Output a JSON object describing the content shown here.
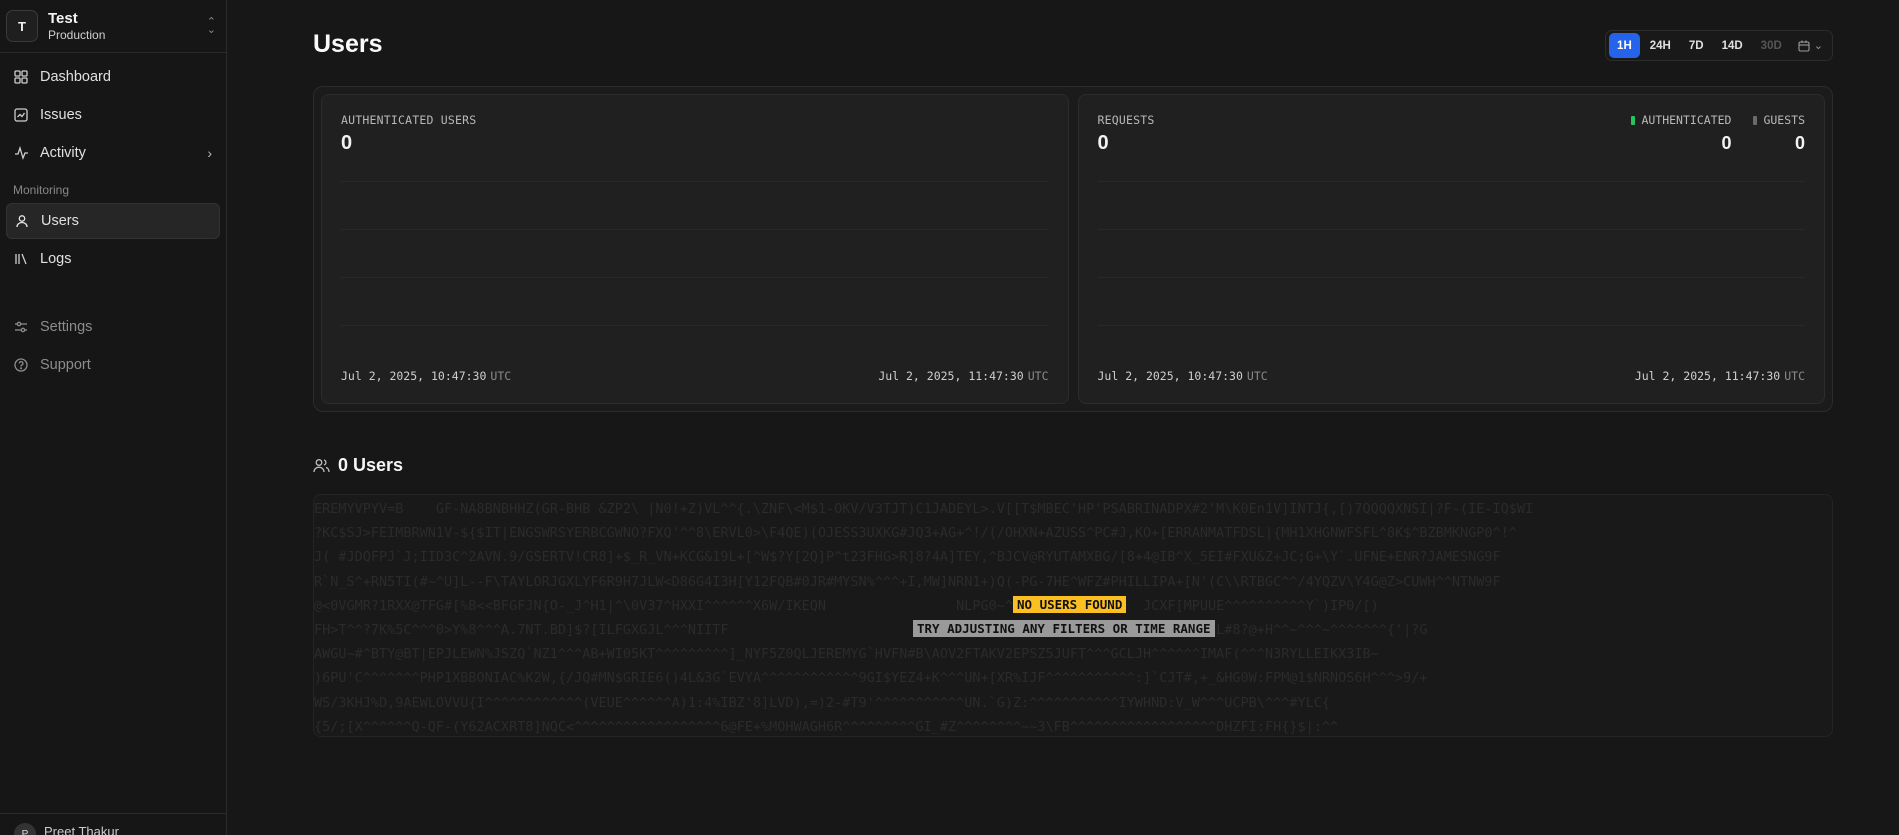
{
  "org": {
    "initial": "T",
    "name": "Test",
    "environment": "Production"
  },
  "nav": {
    "dashboard": "Dashboard",
    "issues": "Issues",
    "activity": "Activity",
    "section_monitoring": "Monitoring",
    "users": "Users",
    "logs": "Logs",
    "settings": "Settings",
    "support": "Support"
  },
  "footer": {
    "initial": "P",
    "name": "Preet Thakur"
  },
  "page": {
    "title": "Users"
  },
  "time_range": {
    "options": [
      "1H",
      "24H",
      "7D",
      "14D",
      "30D"
    ],
    "selected": "1H",
    "disabled": [
      "30D"
    ]
  },
  "stats": {
    "authenticated_users": {
      "label": "AUTHENTICATED USERS",
      "value": "0",
      "start_time": "Jul 2, 2025, 10:47:30",
      "end_time": "Jul 2, 2025, 11:47:30",
      "tz": "UTC"
    },
    "requests": {
      "label": "REQUESTS",
      "value": "0",
      "authenticated_label": "AUTHENTICATED",
      "authenticated_value": "0",
      "guests_label": "GUESTS",
      "guests_value": "0",
      "start_time": "Jul 2, 2025, 10:47:30",
      "end_time": "Jul 2, 2025, 11:47:30",
      "tz": "UTC"
    }
  },
  "users_section": {
    "title": "0 Users"
  },
  "empty_state": {
    "title": "NO USERS FOUND",
    "hint": "TRY ADJUSTING ANY FILTERS OR TIME RANGE"
  },
  "colors": {
    "accent": "#2563eb",
    "authenticated": "#22c55e",
    "badge_warning": "#fbbf24"
  }
}
